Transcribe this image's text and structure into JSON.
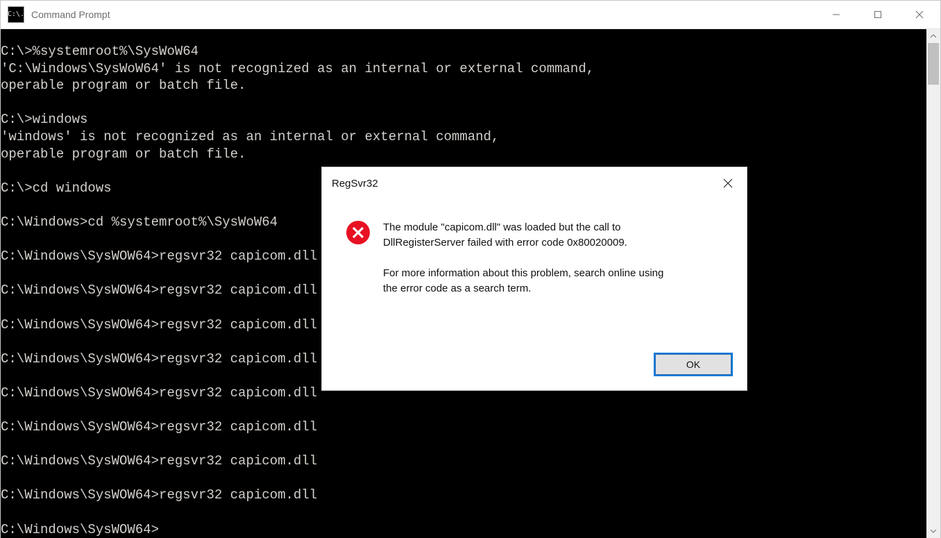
{
  "window": {
    "title": "Command Prompt"
  },
  "terminal": {
    "lines": [
      "C:\\>%systemroot%\\SysWoW64",
      "'C:\\Windows\\SysWoW64' is not recognized as an internal or external command,",
      "operable program or batch file.",
      "",
      "C:\\>windows",
      "'windows' is not recognized as an internal or external command,",
      "operable program or batch file.",
      "",
      "C:\\>cd windows",
      "",
      "C:\\Windows>cd %systemroot%\\SysWoW64",
      "",
      "C:\\Windows\\SysWOW64>regsvr32 capicom.dll",
      "",
      "C:\\Windows\\SysWOW64>regsvr32 capicom.dll",
      "",
      "C:\\Windows\\SysWOW64>regsvr32 capicom.dll",
      "",
      "C:\\Windows\\SysWOW64>regsvr32 capicom.dll",
      "",
      "C:\\Windows\\SysWOW64>regsvr32 capicom.dll",
      "",
      "C:\\Windows\\SysWOW64>regsvr32 capicom.dll",
      "",
      "C:\\Windows\\SysWOW64>regsvr32 capicom.dll",
      "",
      "C:\\Windows\\SysWOW64>regsvr32 capicom.dll",
      "",
      "C:\\Windows\\SysWOW64>"
    ]
  },
  "dialog": {
    "title": "RegSvr32",
    "message_line1": "The module \"capicom.dll\" was loaded but the call to",
    "message_line2": "DllRegisterServer failed with error code 0x80020009.",
    "message_line3": "For more information about this problem, search online using",
    "message_line4": "the error code as a search term.",
    "ok_label": "OK"
  }
}
